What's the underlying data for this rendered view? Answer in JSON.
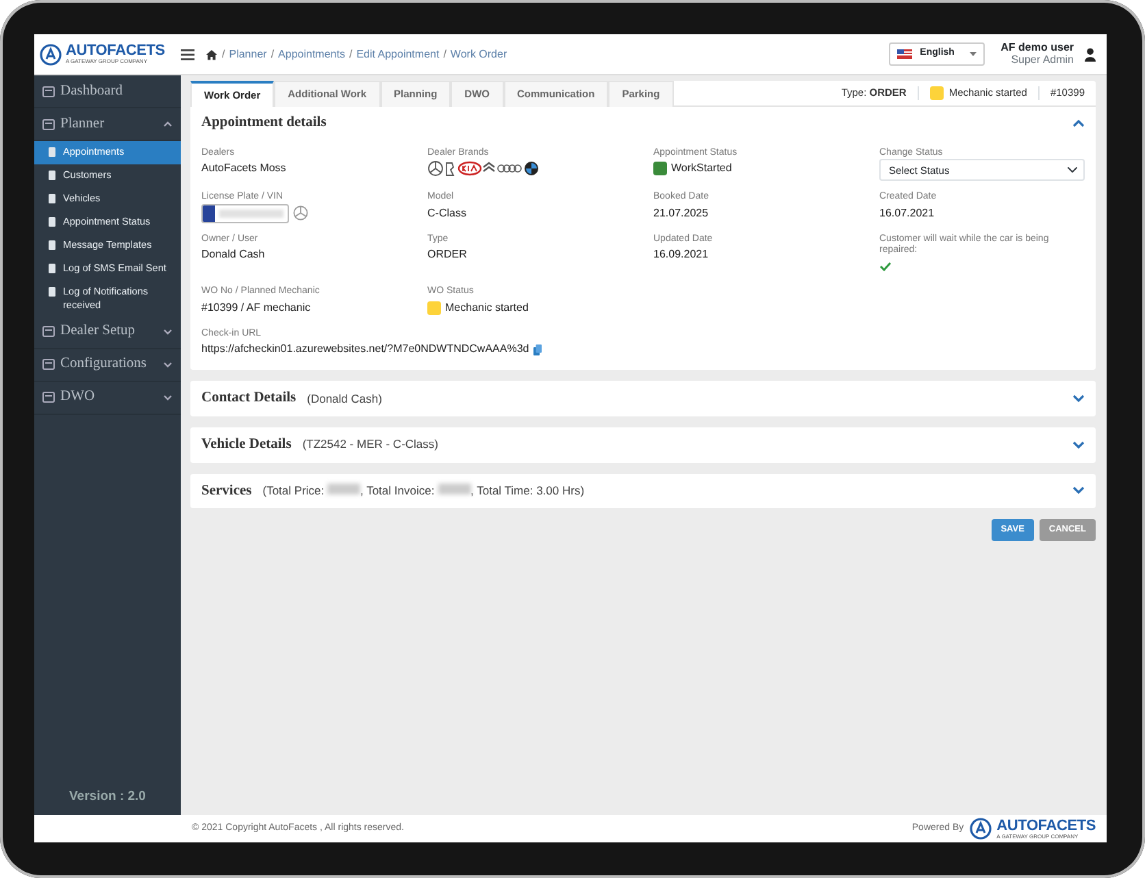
{
  "header": {
    "logo": "AUTOFACETS",
    "logo_tagline": "A GATEWAY GROUP COMPANY",
    "breadcrumb_separator": "/",
    "breadcrumb": [
      "Planner",
      "Appointments",
      "Edit Appointment",
      "Work Order"
    ],
    "language": "English",
    "user_name": "AF demo user",
    "user_role": "Super Admin"
  },
  "sidebar": {
    "items": [
      {
        "label": "Dashboard",
        "kind": "link"
      },
      {
        "label": "Planner",
        "kind": "group",
        "expanded": true,
        "children": [
          {
            "label": "Appointments",
            "selected": true
          },
          {
            "label": "Customers",
            "selected": false
          },
          {
            "label": "Vehicles",
            "selected": false
          },
          {
            "label": "Appointment Status",
            "selected": false
          },
          {
            "label": "Message Templates",
            "selected": false
          },
          {
            "label": "Log of SMS Email Sent",
            "selected": false
          },
          {
            "label": "Log of Notifications received",
            "selected": false
          }
        ]
      },
      {
        "label": "Dealer Setup",
        "kind": "group",
        "expanded": false
      },
      {
        "label": "Configurations",
        "kind": "group",
        "expanded": false
      },
      {
        "label": "DWO",
        "kind": "group",
        "expanded": false
      }
    ],
    "version": "Version : 2.0"
  },
  "tabs": [
    {
      "label": "Work Order",
      "selected": true
    },
    {
      "label": "Additional Work",
      "selected": false
    },
    {
      "label": "Planning",
      "selected": false
    },
    {
      "label": "DWO",
      "selected": false
    },
    {
      "label": "Communication",
      "selected": false
    },
    {
      "label": "Parking",
      "selected": false
    }
  ],
  "summary": {
    "type_label": "Type:",
    "type_value": "ORDER",
    "wo_status": {
      "label": "Mechanic started",
      "color": "#fdd33a"
    },
    "wo_number": "#10399"
  },
  "appointment_details": {
    "title": "Appointment details",
    "expanded": true,
    "fields": [
      {
        "label": "Dealers",
        "kind": "text",
        "value": "AutoFacets Moss"
      },
      {
        "label": "Dealer Brands",
        "kind": "brands"
      },
      {
        "label": "Appointment Status",
        "kind": "status",
        "value": "WorkStarted",
        "color": "#3a8b3a"
      },
      {
        "label": "Change Status",
        "kind": "select",
        "placeholder": "Select Status"
      },
      {
        "label": "License Plate / VIN",
        "kind": "plate"
      },
      {
        "label": "Model",
        "kind": "text",
        "value": "C-Class"
      },
      {
        "label": "Booked Date",
        "kind": "text",
        "value": "21.07.2025"
      },
      {
        "label": "Created Date",
        "kind": "text",
        "value": "16.07.2021"
      },
      {
        "label": "Owner / User",
        "kind": "text",
        "value": "Donald Cash"
      },
      {
        "label": "Type",
        "kind": "text",
        "value": "ORDER"
      },
      {
        "label": "Updated Date",
        "kind": "text",
        "value": "16.09.2021"
      },
      {
        "label": "Customer will wait while the car is being repaired:",
        "kind": "check",
        "checked": true
      },
      {
        "label": "WO No / Planned Mechanic",
        "kind": "text",
        "value": "#10399 / AF mechanic"
      },
      {
        "label": "WO Status",
        "kind": "status",
        "value": "Mechanic started",
        "color": "#fdd33a"
      },
      {
        "label": "Check-in URL",
        "kind": "url",
        "value": "https://afcheckin01.azurewebsites.net/?M7e0NDWTNDCwAAA%3d"
      }
    ]
  },
  "sections": [
    {
      "title": "Contact Details",
      "subtitle_parts": [
        "(Donald Cash)"
      ],
      "expanded": false
    },
    {
      "title": "Vehicle Details",
      "subtitle_parts": [
        "(TZ2542 - MER - C-Class)"
      ],
      "expanded": false
    },
    {
      "title": "Services",
      "subtitle_parts": [
        "(Total Price: ",
        ", Total Invoice: ",
        ", Total Time: 3.00 Hrs)"
      ],
      "expanded": false
    }
  ],
  "buttons": [
    {
      "label": "SAVE",
      "kind": "primary"
    },
    {
      "label": "CANCEL",
      "kind": "secondary"
    }
  ],
  "footer": {
    "copyright_before": "© 2021 Copyright ",
    "link": "AutoFacets",
    "copyright_after": " , All rights reserved.",
    "powered_by": "Powered By",
    "logo": "AUTOFACETS",
    "logo_tagline": "A GATEWAY GROUP COMPANY"
  }
}
